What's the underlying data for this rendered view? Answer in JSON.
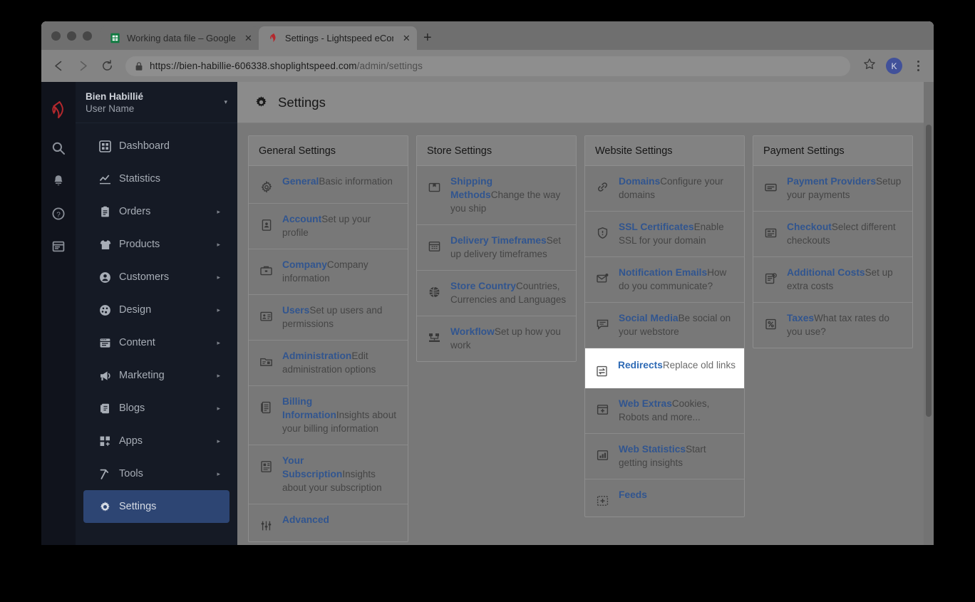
{
  "browser": {
    "traffic_lights": [
      "close",
      "minimize",
      "maximize"
    ],
    "tabs": [
      {
        "title": "Working data file – Google She",
        "favicon": "google-sheets-icon",
        "active": false,
        "close_label": "✕"
      },
      {
        "title": "Settings - Lightspeed eCom",
        "favicon": "lightspeed-flame-icon",
        "active": true,
        "close_label": "✕"
      }
    ],
    "new_tab_label": "+",
    "nav": {
      "back": "←",
      "forward": "→",
      "reload": "⟳"
    },
    "url_secure_label": "https://",
    "url_host": "bien-habillie-606338.shoplightspeed.com",
    "url_path": "/admin/settings",
    "bookmark_label": "☆",
    "avatar_initial": "K",
    "menu_label": "kebab-menu"
  },
  "sidebar": {
    "logo": "lightspeed-flame-logo",
    "rail_icons": [
      {
        "name": "search-icon"
      },
      {
        "name": "notifications-bell-icon"
      },
      {
        "name": "help-question-icon"
      },
      {
        "name": "webstore-window-icon"
      }
    ],
    "account": {
      "store_name": "Bien Habillié",
      "user_name": "User Name",
      "caret": "▾"
    },
    "items": [
      {
        "label": "Dashboard",
        "icon": "dashboard-grid-icon",
        "arrow": "",
        "active": false
      },
      {
        "label": "Statistics",
        "icon": "statistics-chart-icon",
        "arrow": "",
        "active": false
      },
      {
        "label": "Orders",
        "icon": "orders-clipboard-icon",
        "arrow": "▸",
        "active": false
      },
      {
        "label": "Products",
        "icon": "products-shirt-icon",
        "arrow": "▸",
        "active": false
      },
      {
        "label": "Customers",
        "icon": "customers-person-icon",
        "arrow": "▸",
        "active": false
      },
      {
        "label": "Design",
        "icon": "design-palette-icon",
        "arrow": "▸",
        "active": false
      },
      {
        "label": "Content",
        "icon": "content-window-icon",
        "arrow": "▸",
        "active": false
      },
      {
        "label": "Marketing",
        "icon": "marketing-megaphone-icon",
        "arrow": "▸",
        "active": false
      },
      {
        "label": "Blogs",
        "icon": "blogs-book-icon",
        "arrow": "▸",
        "active": false
      },
      {
        "label": "Apps",
        "icon": "apps-grid-plus-icon",
        "arrow": "▸",
        "active": false
      },
      {
        "label": "Tools",
        "icon": "tools-hammer-icon",
        "arrow": "▸",
        "active": false
      },
      {
        "label": "Settings",
        "icon": "settings-gear-icon",
        "arrow": "",
        "active": true
      }
    ]
  },
  "page": {
    "title": "Settings",
    "title_icon": "gear-icon"
  },
  "columns": [
    {
      "heading": "General Settings",
      "rows": [
        {
          "title": "General",
          "sub": "Basic information",
          "icon": "gear-icon",
          "highlight": false
        },
        {
          "title": "Account",
          "sub": "Set up your profile",
          "icon": "id-card-icon",
          "highlight": false
        },
        {
          "title": "Company",
          "sub": "Company information",
          "icon": "briefcase-icon",
          "highlight": false
        },
        {
          "title": "Users",
          "sub": "Set up users and permissions",
          "icon": "users-badge-icon",
          "highlight": false
        },
        {
          "title": "Administration",
          "sub": "Edit administration options",
          "icon": "admin-folder-icon",
          "highlight": false
        },
        {
          "title": "Billing Information",
          "sub": "Insights about your billing information",
          "icon": "invoice-icon",
          "highlight": false
        },
        {
          "title": "Your Subscription",
          "sub": "Insights about your subscription",
          "icon": "subscription-doc-icon",
          "highlight": false
        },
        {
          "title": "Advanced",
          "sub": "",
          "icon": "advanced-sliders-icon",
          "highlight": false
        }
      ]
    },
    {
      "heading": "Store Settings",
      "rows": [
        {
          "title": "Shipping Methods",
          "sub": "Change the way you ship",
          "icon": "shipping-box-icon",
          "highlight": false
        },
        {
          "title": "Delivery Timeframes",
          "sub": "Set up delivery timeframes",
          "icon": "calendar-grid-icon",
          "highlight": false
        },
        {
          "title": "Store Country",
          "sub": "Countries, Currencies and Languages",
          "icon": "globe-icon",
          "highlight": false
        },
        {
          "title": "Workflow",
          "sub": "Set up how you work",
          "icon": "workflow-nodes-icon",
          "highlight": false
        }
      ]
    },
    {
      "heading": "Website Settings",
      "rows": [
        {
          "title": "Domains",
          "sub": "Configure your domains",
          "icon": "link-chain-icon",
          "highlight": false
        },
        {
          "title": "SSL Certificates",
          "sub": "Enable SSL for your domain",
          "icon": "shield-icon",
          "highlight": false
        },
        {
          "title": "Notification Emails",
          "sub": "How do you communicate?",
          "icon": "envelope-icon",
          "highlight": false
        },
        {
          "title": "Social Media",
          "sub": "Be social on your webstore",
          "icon": "speech-bubble-icon",
          "highlight": false
        },
        {
          "title": "Redirects",
          "sub": "Replace old links",
          "icon": "redirect-arrows-icon",
          "highlight": true
        },
        {
          "title": "Web Extras",
          "sub": "Cookies, Robots and more...",
          "icon": "web-extras-plus-icon",
          "highlight": false
        },
        {
          "title": "Web Statistics",
          "sub": "Start getting insights",
          "icon": "bar-chart-box-icon",
          "highlight": false
        },
        {
          "title": "Feeds",
          "sub": "",
          "icon": "feeds-plus-icon",
          "highlight": false
        }
      ]
    },
    {
      "heading": "Payment Settings",
      "rows": [
        {
          "title": "Payment Providers",
          "sub": "Setup your payments",
          "icon": "credit-card-icon",
          "highlight": false
        },
        {
          "title": "Checkout",
          "sub": "Select different checkouts",
          "icon": "checkout-register-icon",
          "highlight": false
        },
        {
          "title": "Additional Costs",
          "sub": "Set up extra costs",
          "icon": "additional-costs-doc-icon",
          "highlight": false
        },
        {
          "title": "Taxes",
          "sub": "What tax rates do you use?",
          "icon": "percent-box-icon",
          "highlight": false
        }
      ]
    }
  ],
  "colors": {
    "dim_overlay": "#787878",
    "sidebar_dark": "#151a25",
    "rail_dark": "#10131c",
    "link_blue": "#31558f",
    "highlight_blue": "#2e6ab5",
    "active_nav": "#2d4573",
    "avatar_blue": "#41519a",
    "lightspeed_red": "#b4282d"
  },
  "scroll": {
    "vertical_position_pct": 0
  }
}
